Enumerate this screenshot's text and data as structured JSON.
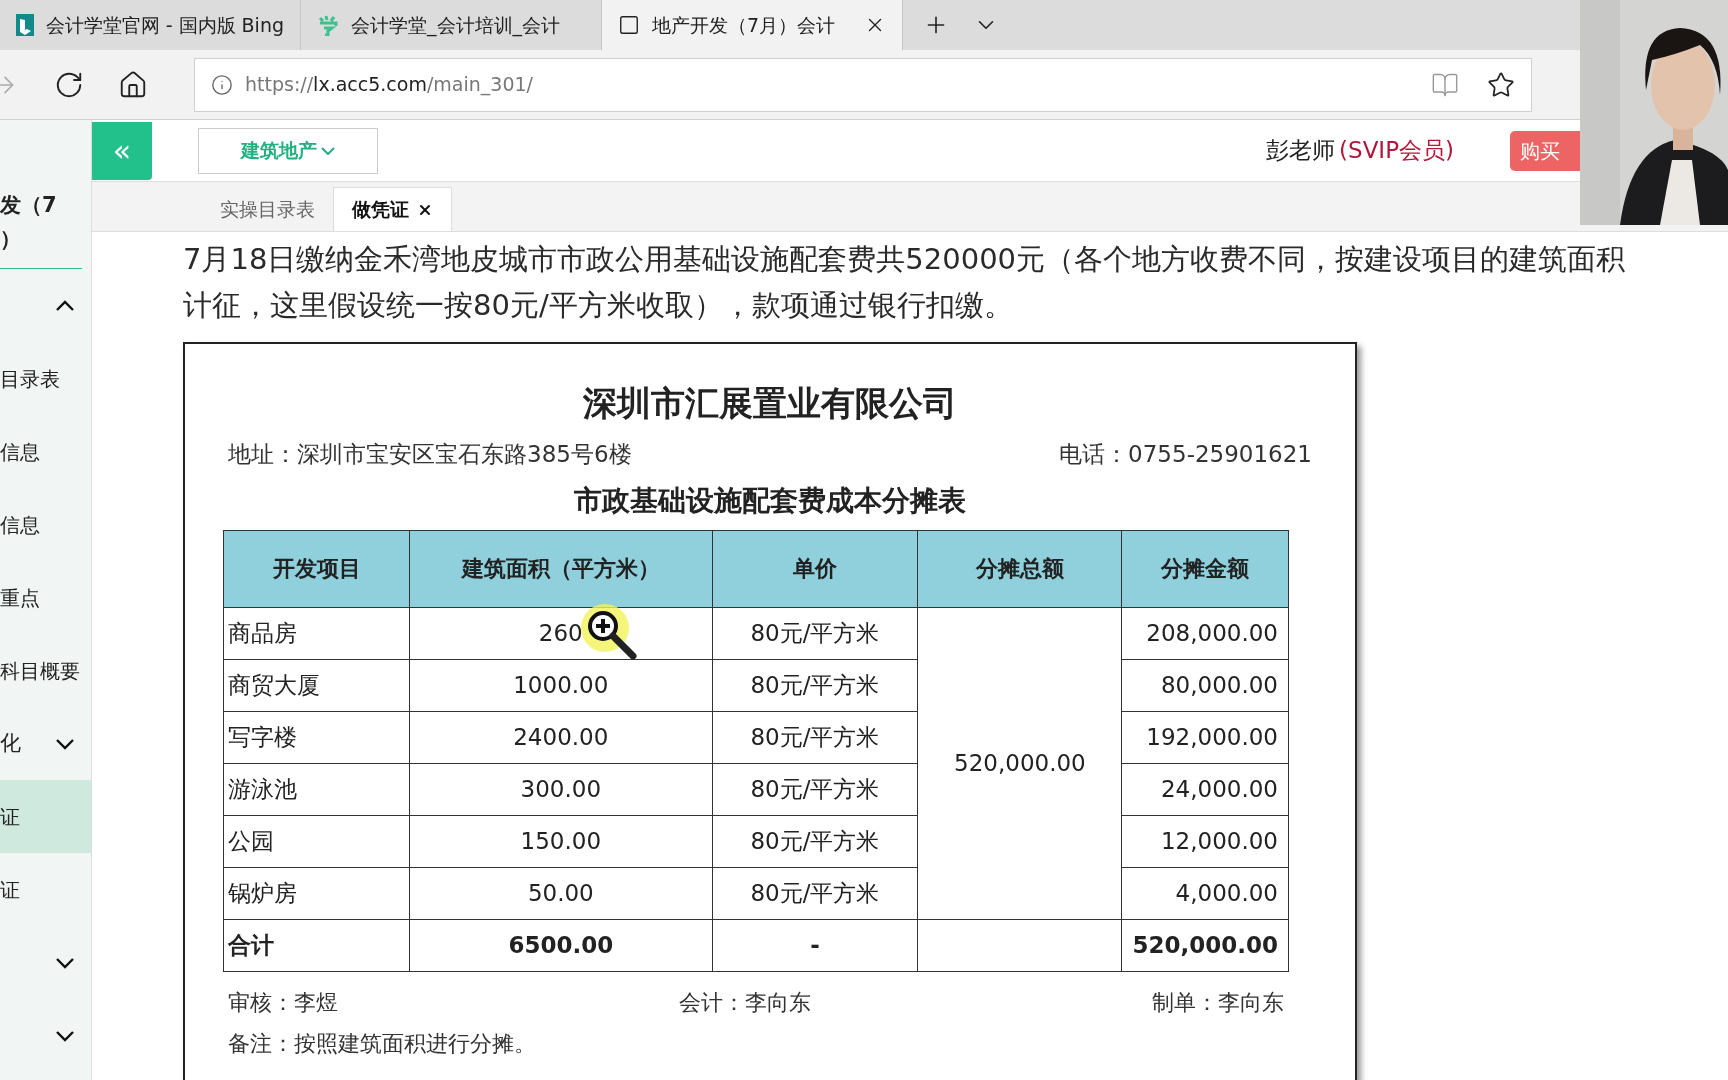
{
  "browser_tabs": [
    {
      "title": "会计学堂官网 - 国内版 Bing",
      "selected": false
    },
    {
      "title": "会计学堂_会计培训_会计",
      "selected": false
    },
    {
      "title": "地产开发（7月）会计",
      "selected": true
    }
  ],
  "address_bar": {
    "scheme": "https://",
    "host": "lx.acc5.com",
    "path": "/main_301/"
  },
  "header": {
    "collapse_button": "«",
    "dropdown": "建筑地产",
    "user": "彭老师",
    "membership": "(SVIP会员)",
    "buy_button": "购买"
  },
  "sidebar": {
    "title_lines": [
      "发（7",
      "）"
    ],
    "items": [
      {
        "kind": "toggle",
        "expanded": true,
        "selected": false
      },
      {
        "kind": "link",
        "label": "目录表",
        "selected": false
      },
      {
        "kind": "link",
        "label": "信息",
        "selected": false
      },
      {
        "kind": "link",
        "label": "信息",
        "selected": false
      },
      {
        "kind": "link",
        "label": "重点",
        "selected": false
      },
      {
        "kind": "link",
        "label": "科目概要",
        "selected": false
      },
      {
        "kind": "group",
        "label": "化",
        "expanded": false,
        "selected": false
      },
      {
        "kind": "link",
        "label": "证",
        "selected": true
      },
      {
        "kind": "link",
        "label": "证",
        "selected": false
      },
      {
        "kind": "toggle",
        "expanded": false,
        "selected": false
      },
      {
        "kind": "toggle",
        "expanded": false,
        "selected": false
      }
    ]
  },
  "page_tabs": [
    {
      "label": "实操目录表",
      "selected": false,
      "closable": false
    },
    {
      "label": "做凭证",
      "selected": true,
      "closable": true
    }
  ],
  "question": "7月18日缴纳金禾湾地皮城市市政公用基础设施配套费共520000元（各个地方收费不同，按建设项目的建筑面积计征，这里假设统一按80元/平方米收取），款项通过银行扣缴。",
  "document": {
    "company": "深圳市汇展置业有限公司",
    "address": "地址：深圳市宝安区宝石东路385号6楼",
    "phone": "电话：0755-25901621",
    "table_title": "市政基础设施配套费成本分摊表",
    "table": {
      "columns": [
        "开发项目",
        "建筑面积（平方米）",
        "单价",
        "分摊总额",
        "分摊金额"
      ],
      "rows": [
        [
          "商品房",
          "260",
          "80元/平方米",
          "208,000.00"
        ],
        [
          "商贸大厦",
          "1000.00",
          "80元/平方米",
          "80,000.00"
        ],
        [
          "写字楼",
          "2400.00",
          "80元/平方米",
          "192,000.00"
        ],
        [
          "游泳池",
          "300.00",
          "80元/平方米",
          "24,000.00"
        ],
        [
          "公园",
          "150.00",
          "80元/平方米",
          "12,000.00"
        ],
        [
          "锅炉房",
          "50.00",
          "80元/平方米",
          "4,000.00"
        ]
      ],
      "merged_total": "520,000.00",
      "total_row": {
        "label": "合计",
        "area": "6500.00",
        "price": "-",
        "amount": "520,000.00"
      }
    },
    "signatures": [
      "审核：李煜",
      "会计：李向东",
      "制单：李向东"
    ],
    "note": "备注：按照建筑面积进行分摊。"
  }
}
